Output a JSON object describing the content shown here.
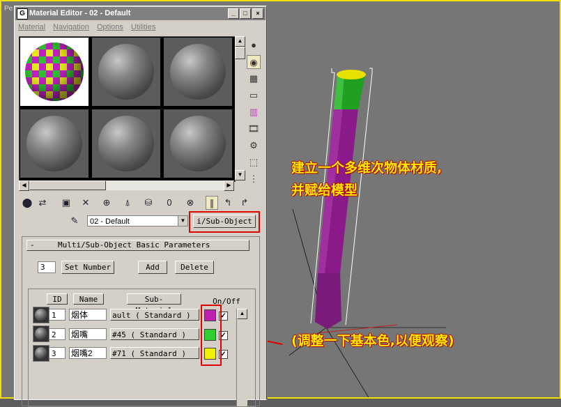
{
  "viewport": {
    "label": "Pe"
  },
  "annotations": {
    "line1": "建立一个多维次物体材质,",
    "line2": "并赋给模型",
    "line3": "(调整一下基本色,以便观察)"
  },
  "window": {
    "title": "Material Editor - 02 - Default",
    "title_icon": "G",
    "minimize_glyph": "_",
    "maximize_glyph": "□",
    "close_glyph": "×"
  },
  "menu": [
    "Material",
    "Navigation",
    "Options",
    "Utilities"
  ],
  "name_row": {
    "material_name": "02 - Default",
    "type_button": "i/Sub-Object"
  },
  "rollout": {
    "collapse": "-",
    "title": "Multi/Sub-Object Basic Parameters",
    "count": "3",
    "set_number": "Set Number",
    "add": "Add",
    "delete": "Delete"
  },
  "grid": {
    "headers": {
      "id": "ID",
      "name": "Name",
      "sub_material": "Sub-Material",
      "on_off": "On/Off"
    },
    "rows": [
      {
        "id": "1",
        "name": "烟体",
        "material": "ault  ( Standard )",
        "color": "#c020b0",
        "on": "✓"
      },
      {
        "id": "2",
        "name": "烟嘴",
        "material": "#45  ( Standard )",
        "color": "#30d030",
        "on": "✓"
      },
      {
        "id": "3",
        "name": "烟嘴2",
        "material": "#71  ( Standard )",
        "color": "#f0f000",
        "on": "✓"
      }
    ]
  },
  "colors": {
    "accent_red": "#e00000",
    "annotation": "#ffea00"
  }
}
